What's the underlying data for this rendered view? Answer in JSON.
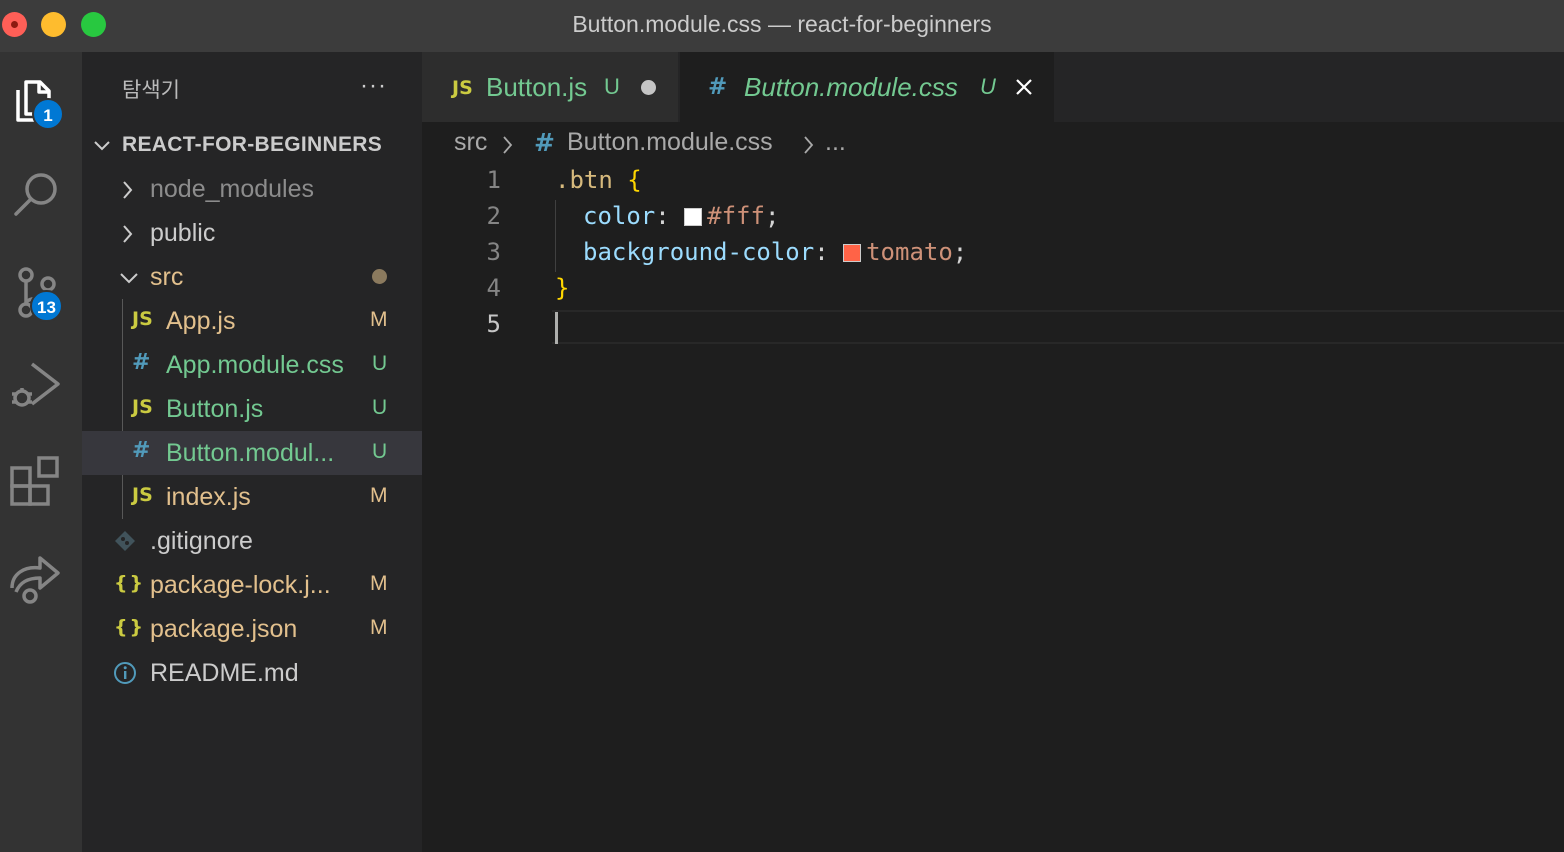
{
  "window": {
    "title": "Button.module.css — react-for-beginners"
  },
  "activity_bar": {
    "explorer_badge": "1",
    "scm_badge": "13"
  },
  "sidebar": {
    "title": "탐색기",
    "more": "···",
    "folder_name": "REACT-FOR-BEGINNERS",
    "items": [
      {
        "name": "node_modules",
        "type": "folder",
        "status": ""
      },
      {
        "name": "public",
        "type": "folder",
        "status": ""
      },
      {
        "name": "src",
        "type": "folder-open",
        "status": ""
      },
      {
        "name": "App.js",
        "icon": "JS",
        "status": "M"
      },
      {
        "name": "App.module.css",
        "icon": "#",
        "status": "U"
      },
      {
        "name": "Button.js",
        "icon": "JS",
        "status": "U"
      },
      {
        "name": "Button.modul...",
        "icon": "#",
        "status": "U"
      },
      {
        "name": "index.js",
        "icon": "JS",
        "status": "M"
      },
      {
        "name": ".gitignore",
        "icon": "git",
        "status": ""
      },
      {
        "name": "package-lock.j...",
        "icon": "{}",
        "status": "M"
      },
      {
        "name": "package.json",
        "icon": "{}",
        "status": "M"
      },
      {
        "name": "README.md",
        "icon": "info",
        "status": ""
      }
    ]
  },
  "tabs": [
    {
      "icon": "JS",
      "label": "Button.js",
      "status": "U"
    },
    {
      "icon": "#",
      "label": "Button.module.css",
      "status": "U"
    }
  ],
  "breadcrumb": {
    "folder": "src",
    "sep": ">",
    "icon": "#",
    "file": "Button.module.css",
    "more": "..."
  },
  "code": {
    "line_numbers": [
      "1",
      "2",
      "3",
      "4",
      "5"
    ],
    "selector": ".btn",
    "open_brace": "{",
    "close_brace": "}",
    "prop1": "color",
    "value1": "#fff",
    "prop2": "background-color",
    "value2": "tomato",
    "colon": ":",
    "semicolon": ";"
  },
  "colors": {
    "js": "#cbcb41",
    "css": "#519aba",
    "modified": "#e2c08d",
    "untracked": "#73c991",
    "swatch_white": "#ffffff",
    "swatch_tomato": "#ff6347"
  }
}
